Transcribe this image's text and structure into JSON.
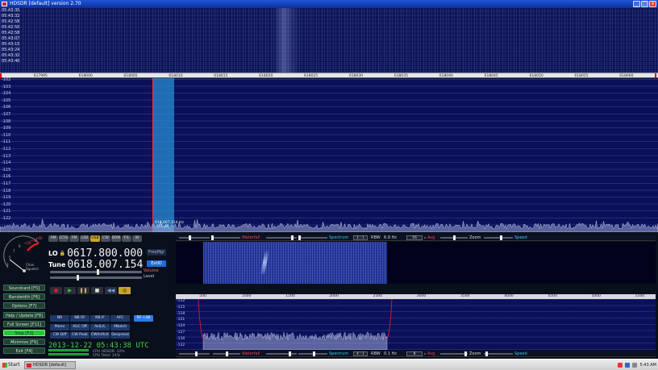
{
  "window": {
    "title": "HDSDR [default]  version 2.70",
    "controls": [
      "_",
      "□",
      "x"
    ]
  },
  "waterfall": {
    "timestamps": [
      "05:43:35",
      "05:43:32",
      "05:42:58",
      "05:42:50",
      "05:42:58",
      "05:43:07",
      "05:43:15",
      "05:43:24",
      "05:43:32",
      "05:43:40"
    ]
  },
  "freq_scale": {
    "ticks": [
      "617995",
      "618000",
      "618005",
      "618010",
      "618015",
      "618020",
      "618025",
      "618030",
      "618035",
      "618040",
      "618045",
      "618050",
      "618055",
      "618060"
    ],
    "tick_values": [
      617995,
      618000,
      618005,
      618010,
      618015,
      618020,
      618025,
      618030,
      618035,
      618040,
      618045,
      618050,
      618055,
      618060
    ],
    "range": [
      617990.5,
      618063.5
    ]
  },
  "spectrum": {
    "db_labels": [
      "-102",
      "-103",
      "-104",
      "-105",
      "-106",
      "-107",
      "-108",
      "-109",
      "-110",
      "-111",
      "-112",
      "-113",
      "-114",
      "-115",
      "-116",
      "-117",
      "-118",
      "-119",
      "-120",
      "-121",
      "-122"
    ],
    "tune_readout": [
      "618,007,154 Hz",
      "-121 dB"
    ]
  },
  "smeter": {
    "scale": [
      "3",
      "5",
      "7",
      "9",
      "+20",
      "+40",
      "+60"
    ],
    "labels": [
      "Chan",
      "Squelch"
    ]
  },
  "mode_buttons": [
    {
      "label": "AM",
      "on": false
    },
    {
      "label": "ECSS",
      "on": false
    },
    {
      "label": "FM",
      "on": false
    },
    {
      "label": "LSB",
      "on": false
    },
    {
      "label": "USB",
      "on": true
    },
    {
      "label": "CW",
      "on": false
    },
    {
      "label": "DRM",
      "on": false
    },
    {
      "label": "FIL",
      "on": false
    },
    {
      "label": "W",
      "on": false
    }
  ],
  "lo": {
    "label": "LO",
    "value": "0617.800.000"
  },
  "tune": {
    "label": "Tune",
    "value": "0618.007.154"
  },
  "side_buttons": {
    "freqmgr": "FreqMgr",
    "extio": "ExtIO"
  },
  "slider_labels": {
    "volume": "Volume",
    "level": "Level"
  },
  "sliders": {
    "volume": 0.52,
    "level": 0.3
  },
  "transport": [
    {
      "name": "record-icon",
      "glyph": "●",
      "color": "#d22",
      "bg": "#2a2f3a"
    },
    {
      "name": "play-icon",
      "glyph": "▶",
      "color": "#3c3",
      "bg": "#2a2f3a"
    },
    {
      "name": "pause-icon",
      "glyph": "❚❚",
      "color": "#cb2",
      "bg": "#2a2f3a"
    },
    {
      "name": "stop-icon",
      "glyph": "■",
      "color": "#ddd",
      "bg": "#2a2f3a"
    },
    {
      "name": "rewind-icon",
      "glyph": "◀◀",
      "color": "#6af",
      "bg": "#2a2f3a"
    },
    {
      "name": "loop-icon",
      "glyph": "◎",
      "color": "#111",
      "bg": "#c9a52a"
    }
  ],
  "left_buttons": [
    {
      "label": "Soundcard  [F5]",
      "active": false
    },
    {
      "label": "Bandwidth  [F6]",
      "active": false
    },
    {
      "label": "Options  [F7]",
      "active": false
    },
    {
      "label": "Help / Update  [F8]",
      "active": false
    },
    {
      "label": "Full Screen  [F11]",
      "active": false
    },
    {
      "label": "Stop  [F2]",
      "active": true
    },
    {
      "label": "Minimize  [F9]",
      "active": false
    },
    {
      "label": "Exit  [F4]",
      "active": false
    }
  ],
  "dsp_buttons": [
    {
      "label": "NR",
      "on": false
    },
    {
      "label": "NB RF",
      "on": false
    },
    {
      "label": "NB IF",
      "on": false
    },
    {
      "label": "AFC",
      "on": false
    },
    {
      "label": "RF +36",
      "on": true
    },
    {
      "label": "Mono",
      "on": false
    },
    {
      "label": "AGC Off",
      "on": false
    },
    {
      "label": "AvlLrL",
      "on": false
    },
    {
      "label": "ANotch",
      "on": false
    },
    {
      "label": "CW Diff",
      "on": false
    },
    {
      "label": "CW Peak",
      "on": false
    },
    {
      "label": "CW/Infinit",
      "on": false
    },
    {
      "label": "Despread",
      "on": false
    }
  ],
  "clock": {
    "date": "2013-12-22",
    "time": "05:43:38 UTC"
  },
  "cpu": {
    "hdsdr": "CPU HDSDR:  12%",
    "total": "CPU Total:  24%"
  },
  "rf_bar": {
    "waterfall": "Waterfall",
    "spectrum": "Spectrum",
    "rbw_label": "RBW",
    "rbw_value": "6.9 Hz",
    "box1": "1 : 1",
    "box2": "16",
    "avg": "Avg",
    "zoom": "Zoom",
    "speed": "Speed"
  },
  "af_scale": {
    "ticks": [
      "500",
      "1000",
      "1500",
      "2000",
      "2500",
      "3000",
      "3500",
      "4000",
      "4500",
      "5000",
      "5500"
    ],
    "tick_values": [
      500,
      1000,
      1500,
      2000,
      2500,
      3000,
      3500,
      4000,
      4500,
      5000,
      5500
    ],
    "range": [
      190,
      5680
    ]
  },
  "af_spectrum": {
    "db_labels": [
      "-112",
      "-115",
      "-118",
      "-121",
      "-124",
      "-127",
      "-130",
      "-132"
    ]
  },
  "af_bar": {
    "waterfall": "Waterfall",
    "spectrum": "Spectrum",
    "rbw_label": "RBW",
    "rbw_value": "0.1 Hz",
    "box1": "4 : 1",
    "box2": "8",
    "avg": "Avg",
    "zoom": "Zoom",
    "speed": "Speed"
  },
  "taskbar": {
    "start": "Start",
    "task": "HDSDR [default]  vers...",
    "clock": "5:43 AM"
  },
  "colors": {
    "accent": "#1e6cd6",
    "spectrum_bg": "#0b1058",
    "active_green": "#29c43c",
    "tune_red": "#ff3030"
  }
}
